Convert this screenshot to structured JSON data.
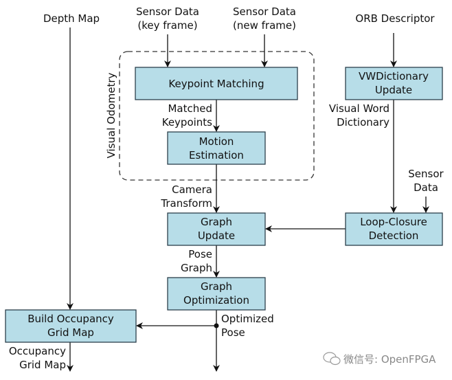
{
  "inputs": {
    "depth_map": "Depth Map",
    "sensor_key": [
      "Sensor Data",
      "(key frame)"
    ],
    "sensor_new": [
      "Sensor Data",
      "(new frame)"
    ],
    "orb": "ORB Descriptor",
    "sensor_right": [
      "Sensor",
      "Data"
    ]
  },
  "group": {
    "visual_odometry": "Visual Odometry"
  },
  "boxes": {
    "keypoint_matching": [
      "Keypoint Matching"
    ],
    "motion_estimation": [
      "Motion",
      "Estimation"
    ],
    "graph_update": [
      "Graph",
      "Update"
    ],
    "graph_optimization": [
      "Graph",
      "Optimization"
    ],
    "build_occupancy": [
      "Build Occupancy",
      "Grid Map"
    ],
    "vwdictionary_update": [
      "VWDictionary",
      "Update"
    ],
    "loop_closure": [
      "Loop-Closure",
      "Detection"
    ]
  },
  "edges": {
    "matched_keypoints": [
      "Matched",
      "Keypoints"
    ],
    "camera_transform": [
      "Camera",
      "Transform"
    ],
    "pose_graph": [
      "Pose",
      "Graph"
    ],
    "optimized_pose": [
      "Optimized",
      "Pose"
    ],
    "visual_word_dictionary": [
      "Visual Word",
      "Dictionary"
    ],
    "occupancy_grid_map": [
      "Occupancy",
      "Grid Map"
    ]
  },
  "watermark": "微信号: OpenFPGA"
}
